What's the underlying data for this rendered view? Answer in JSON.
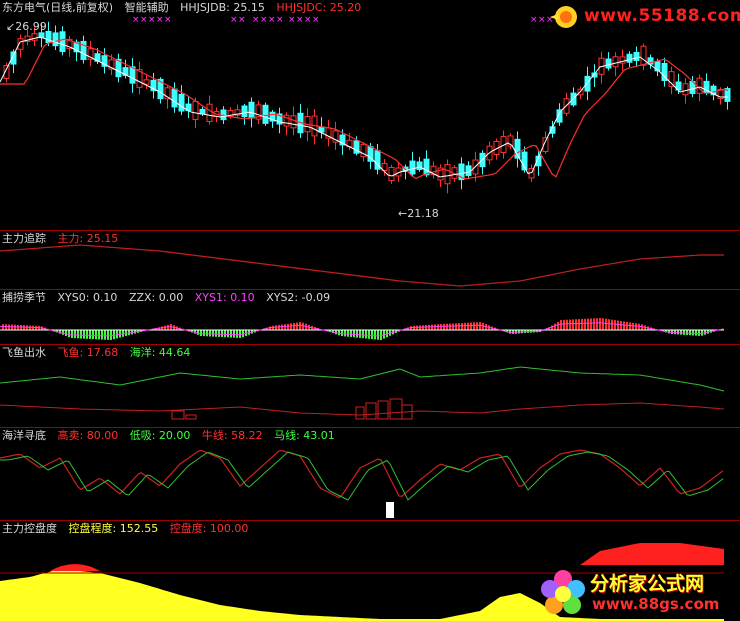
{
  "main": {
    "title": "东方电气(日线,前复权)",
    "indicator": "智能辅助",
    "hhjsjdb_label": "HHJSJDB: 25.15",
    "hhjsjdc_label": "HHJSJDC: 25.20",
    "high_price": "26.99",
    "low_price": "21.18"
  },
  "panels": [
    {
      "name": "主力追踪",
      "items": [
        {
          "text": "主力: 25.15",
          "color": "#ff3030"
        }
      ]
    },
    {
      "name": "捕捞季节",
      "items": [
        {
          "text": "XYS0: 0.10",
          "color": "#d8d8d8"
        },
        {
          "text": "ZZX: 0.00",
          "color": "#d8d8d8"
        },
        {
          "text": "XYS1: 0.10",
          "color": "#ff40ff"
        },
        {
          "text": "XYS2: -0.09",
          "color": "#d8d8d8"
        }
      ]
    },
    {
      "name": "飞鱼出水",
      "items": [
        {
          "text": "飞鱼: 17.68",
          "color": "#ff3030"
        },
        {
          "text": "海洋: 44.64",
          "color": "#40ff40"
        }
      ]
    },
    {
      "name": "海洋寻底",
      "items": [
        {
          "text": "高卖: 80.00",
          "color": "#ff3030"
        },
        {
          "text": "低吸: 20.00",
          "color": "#40ff40"
        },
        {
          "text": "牛线: 58.22",
          "color": "#ff3030"
        },
        {
          "text": "马线: 43.01",
          "color": "#40ff40"
        }
      ]
    },
    {
      "name": "主力控盘度",
      "items": [
        {
          "text": "控盘程度: 152.55",
          "color": "#ffff40"
        },
        {
          "text": "控盘度: 100.00",
          "color": "#ff3030"
        }
      ]
    }
  ],
  "watermark": {
    "url": "www.55188.com"
  },
  "logo": {
    "title": "分析家公式网",
    "url": "www.88gs.com"
  },
  "colors": {
    "up": "#ff3030",
    "down": "#40ffff",
    "ma_fast": "#ffffff",
    "ma_slow": "#ff3030",
    "separator": "#a00000"
  }
}
